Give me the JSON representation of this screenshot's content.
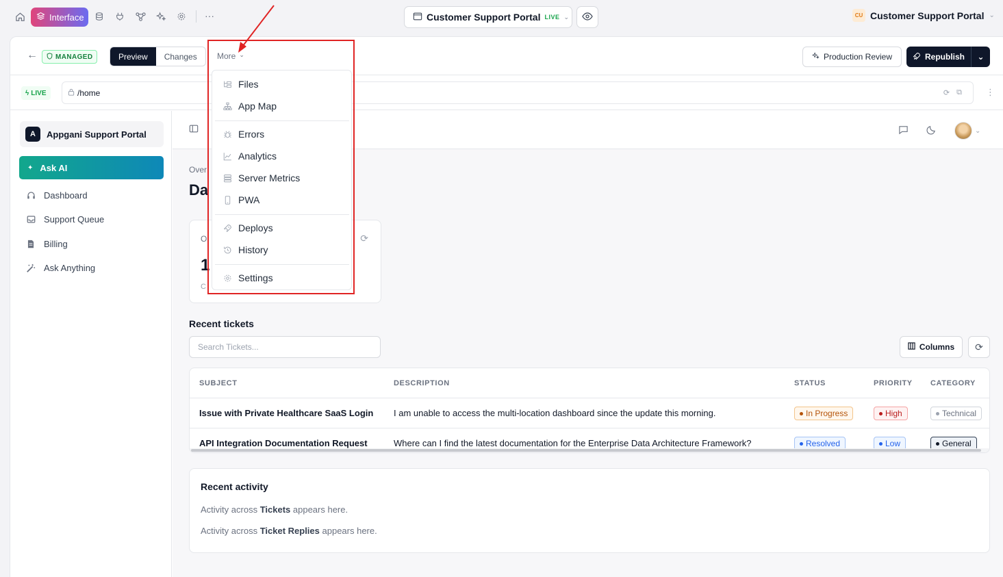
{
  "topbar": {
    "interface_label": "Interface",
    "portal_name": "Customer Support Portal",
    "portal_status": "LIVE",
    "org_initials": "CU",
    "org_name": "Customer Support Portal"
  },
  "toolbar": {
    "managed_label": "MANAGED",
    "preview_label": "Preview",
    "changes_label": "Changes",
    "more_label": "More",
    "production_review_label": "Production Review",
    "republish_label": "Republish"
  },
  "urlbar": {
    "live_label": "LIVE",
    "path": "/home"
  },
  "sidebar": {
    "app_initial": "A",
    "app_name": "Appgani Support Portal",
    "ask_ai_label": "Ask AI",
    "items": [
      {
        "label": "Dashboard",
        "icon": "headset-icon"
      },
      {
        "label": "Support Queue",
        "icon": "inbox-icon"
      },
      {
        "label": "Billing",
        "icon": "document-icon"
      },
      {
        "label": "Ask Anything",
        "icon": "magic-wand-icon"
      }
    ]
  },
  "main": {
    "breadcrumb": "Over",
    "title": "Da",
    "metric": {
      "label": "O",
      "value": "1",
      "sub": "C"
    },
    "recent_tickets_title": "Recent tickets",
    "search_placeholder": "Search Tickets...",
    "columns_label": "Columns",
    "table": {
      "headers": [
        "SUBJECT",
        "DESCRIPTION",
        "STATUS",
        "PRIORITY",
        "CATEGORY"
      ],
      "rows": [
        {
          "subject": "Issue with Private Healthcare SaaS Login",
          "description": "I am unable to access the multi-location dashboard since the update this morning.",
          "status": "In Progress",
          "priority": "High",
          "category": "Technical"
        },
        {
          "subject": "API Integration Documentation Request",
          "description": "Where can I find the latest documentation for the Enterprise Data Architecture Framework?",
          "status": "Resolved",
          "priority": "Low",
          "category": "General"
        }
      ]
    },
    "activity": {
      "title": "Recent activity",
      "line1_prefix": "Activity across ",
      "line1_bold": "Tickets",
      "line1_suffix": " appears here.",
      "line2_prefix": "Activity across ",
      "line2_bold": "Ticket Replies",
      "line2_suffix": " appears here."
    }
  },
  "more_menu": {
    "items": [
      {
        "label": "Files",
        "icon": "files-icon"
      },
      {
        "label": "App Map",
        "icon": "sitemap-icon"
      },
      {
        "label": "Errors",
        "icon": "bug-icon"
      },
      {
        "label": "Analytics",
        "icon": "chart-line-icon"
      },
      {
        "label": "Server Metrics",
        "icon": "server-icon"
      },
      {
        "label": "PWA",
        "icon": "mobile-icon"
      },
      {
        "label": "Deploys",
        "icon": "rocket-icon"
      },
      {
        "label": "History",
        "icon": "history-icon"
      },
      {
        "label": "Settings",
        "icon": "gear-icon"
      }
    ]
  },
  "colors": {
    "accent_dark": "#0f172a",
    "live_green": "#16a34a",
    "annotation_red": "#e02424"
  }
}
